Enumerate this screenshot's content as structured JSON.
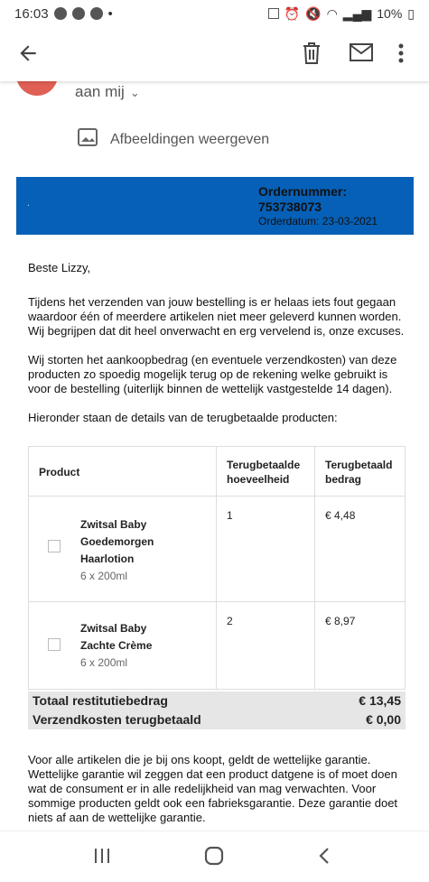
{
  "status": {
    "time": "16:03",
    "battery": "10%"
  },
  "header": {
    "recipient": "aan mij"
  },
  "images": {
    "label": "Afbeeldingen weergeven"
  },
  "order": {
    "number_label": "Ordernummer: 753738073",
    "date_label": "Orderdatum: 23-03-2021"
  },
  "body": {
    "greeting": "Beste Lizzy,",
    "p1": "Tijdens het verzenden van jouw bestelling is er helaas iets fout gegaan waardoor één of meerdere artikelen niet meer geleverd kunnen worden. Wij begrijpen dat dit heel onverwacht en erg vervelend is, onze excuses.",
    "p2": "Wij storten het aankoopbedrag (en eventuele verzendkosten) van deze producten zo spoedig mogelijk terug op de rekening welke gebruikt is voor de bestelling (uiterlijk binnen de wettelijk vastgestelde 14 dagen).",
    "p3": "Hieronder staan de details van de terugbetaalde producten:"
  },
  "table": {
    "headers": [
      "Product",
      "Terugbetaalde hoeveelheid",
      "Terugbetaald bedrag"
    ],
    "rows": [
      {
        "name": "Zwitsal Baby Goedemorgen Haarlotion",
        "size": "6 x 200ml",
        "qty": "1",
        "amount": "€ 4,48"
      },
      {
        "name": "Zwitsal Baby Zachte Crème",
        "size": "6 x 200ml",
        "qty": "2",
        "amount": "€ 8,97"
      }
    ]
  },
  "totals": {
    "refund_label": "Totaal restitutiebedrag",
    "refund_value": "€ 13,45",
    "shipping_label": "Verzendkosten terugbetaald",
    "shipping_value": "€ 0,00"
  },
  "footer": {
    "text": "Voor alle artikelen die je bij ons koopt, geldt de wettelijke garantie. Wettelijke garantie wil zeggen dat een product datgene is of moet doen wat de consument er in alle redelijkheid van mag verwachten. Voor sommige producten geldt ook een fabrieksgarantie. Deze garantie doet niets af aan de wettelijke garantie."
  },
  "colors": {
    "banner": "#0660b7",
    "avatar": "#e06055",
    "totals_bg": "#e6e6e6"
  },
  "icons": [
    "back-arrow-icon",
    "trash-icon",
    "mail-icon",
    "more-vert-icon",
    "chevron-down-icon",
    "image-icon",
    "broken-image-icon",
    "nav-recents-icon",
    "nav-home-icon",
    "nav-back-icon"
  ]
}
